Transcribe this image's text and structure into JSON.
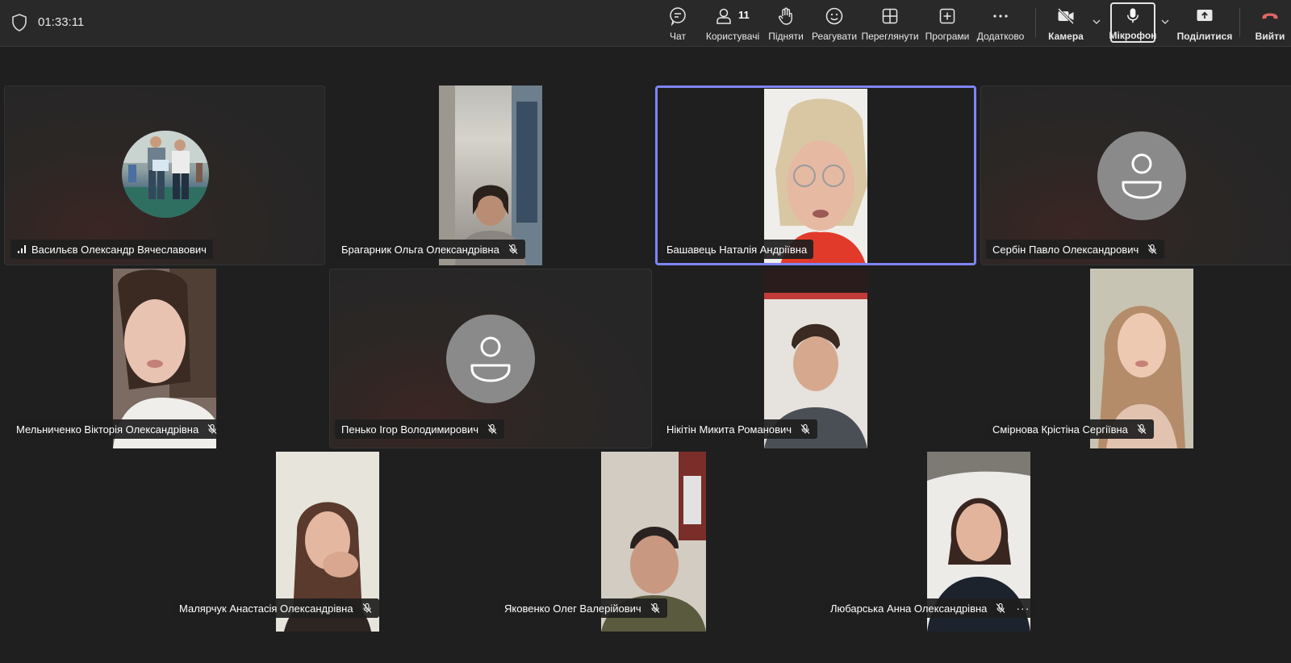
{
  "topbar": {
    "timer": "01:33:11",
    "participant_count": "11",
    "buttons": {
      "chat": "Чат",
      "people": "Користувачі",
      "raise": "Підняти",
      "react": "Реагувати",
      "view": "Переглянути",
      "apps": "Програми",
      "more": "Додатково",
      "camera": "Камера",
      "mic": "Мікрофон",
      "share": "Поділитися",
      "leave": "Вийти"
    },
    "colors": {
      "leave": "#e06666",
      "active_border": "#7f85f5"
    }
  },
  "participants": [
    {
      "name": "Васильєв Олександр Вячеславович",
      "muted": false,
      "speaking_icon": "signal-bars-icon"
    },
    {
      "name": "Брагарник Ольга Олександрівна",
      "muted": true
    },
    {
      "name": "Башавець Наталія Андріївна",
      "muted": false,
      "active": true
    },
    {
      "name": "Сербін Павло Олександрович",
      "muted": true
    },
    {
      "name": "Мельниченко Вікторія Олександрівна",
      "muted": true
    },
    {
      "name": "Пенько Ігор Володимирович",
      "muted": true
    },
    {
      "name": "Нікітін Микита Романович",
      "muted": true
    },
    {
      "name": "Смірнова Крістіна Сергіївна",
      "muted": true
    },
    {
      "name": "Малярчук Анастасія Олександрівна",
      "muted": true
    },
    {
      "name": "Яковенко Олег Валерійович",
      "muted": true
    },
    {
      "name": "Любарська Анна Олександрівна",
      "muted": true,
      "has_more_menu": true
    }
  ]
}
